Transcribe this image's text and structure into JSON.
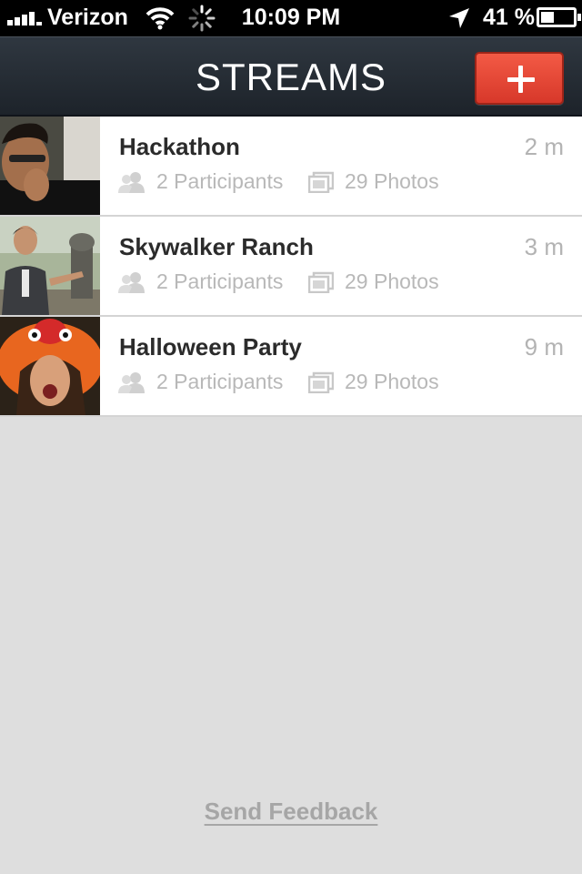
{
  "status_bar": {
    "carrier": "Verizon",
    "time": "10:09 PM",
    "battery": "41 %",
    "battery_level": 0.41
  },
  "nav": {
    "title": "STREAMS",
    "add_button_icon": "plus-icon",
    "add_button_color": "#e5473a"
  },
  "streams": [
    {
      "title": "Hackathon",
      "time": "2 m",
      "participants": "2 Participants",
      "photos": "29 Photos"
    },
    {
      "title": "Skywalker Ranch",
      "time": "3 m",
      "participants": "2 Participants",
      "photos": "29 Photos"
    },
    {
      "title": "Halloween Party",
      "time": "9 m",
      "participants": "2 Participants",
      "photos": "29 Photos"
    }
  ],
  "footer": {
    "feedback_label": "Send Feedback"
  },
  "colors": {
    "background": "#dedede",
    "nav_bar": "#262d35",
    "accent": "#e5473a"
  }
}
